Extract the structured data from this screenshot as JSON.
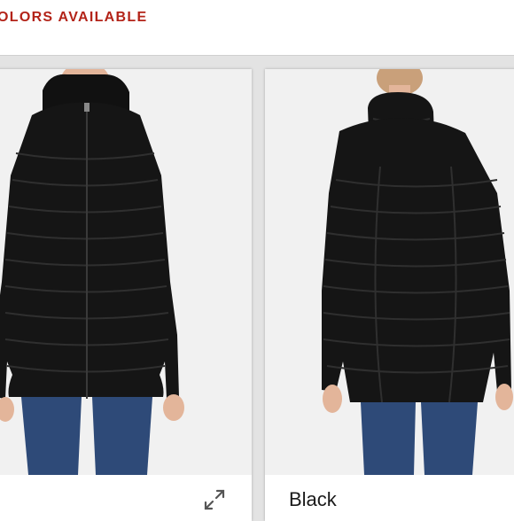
{
  "header": {
    "title": "OLORS AVAILABLE"
  },
  "cards": [
    {
      "color_name": "",
      "view": "front",
      "icon": "expand-icon"
    },
    {
      "color_name": "Black",
      "view": "back"
    }
  ],
  "colors": {
    "accent": "#b32318",
    "jacket": "#151515",
    "jeans": "#2e4a78",
    "skin": "#e3b59a",
    "background": "#e3e3e3",
    "card": "#ffffff"
  }
}
